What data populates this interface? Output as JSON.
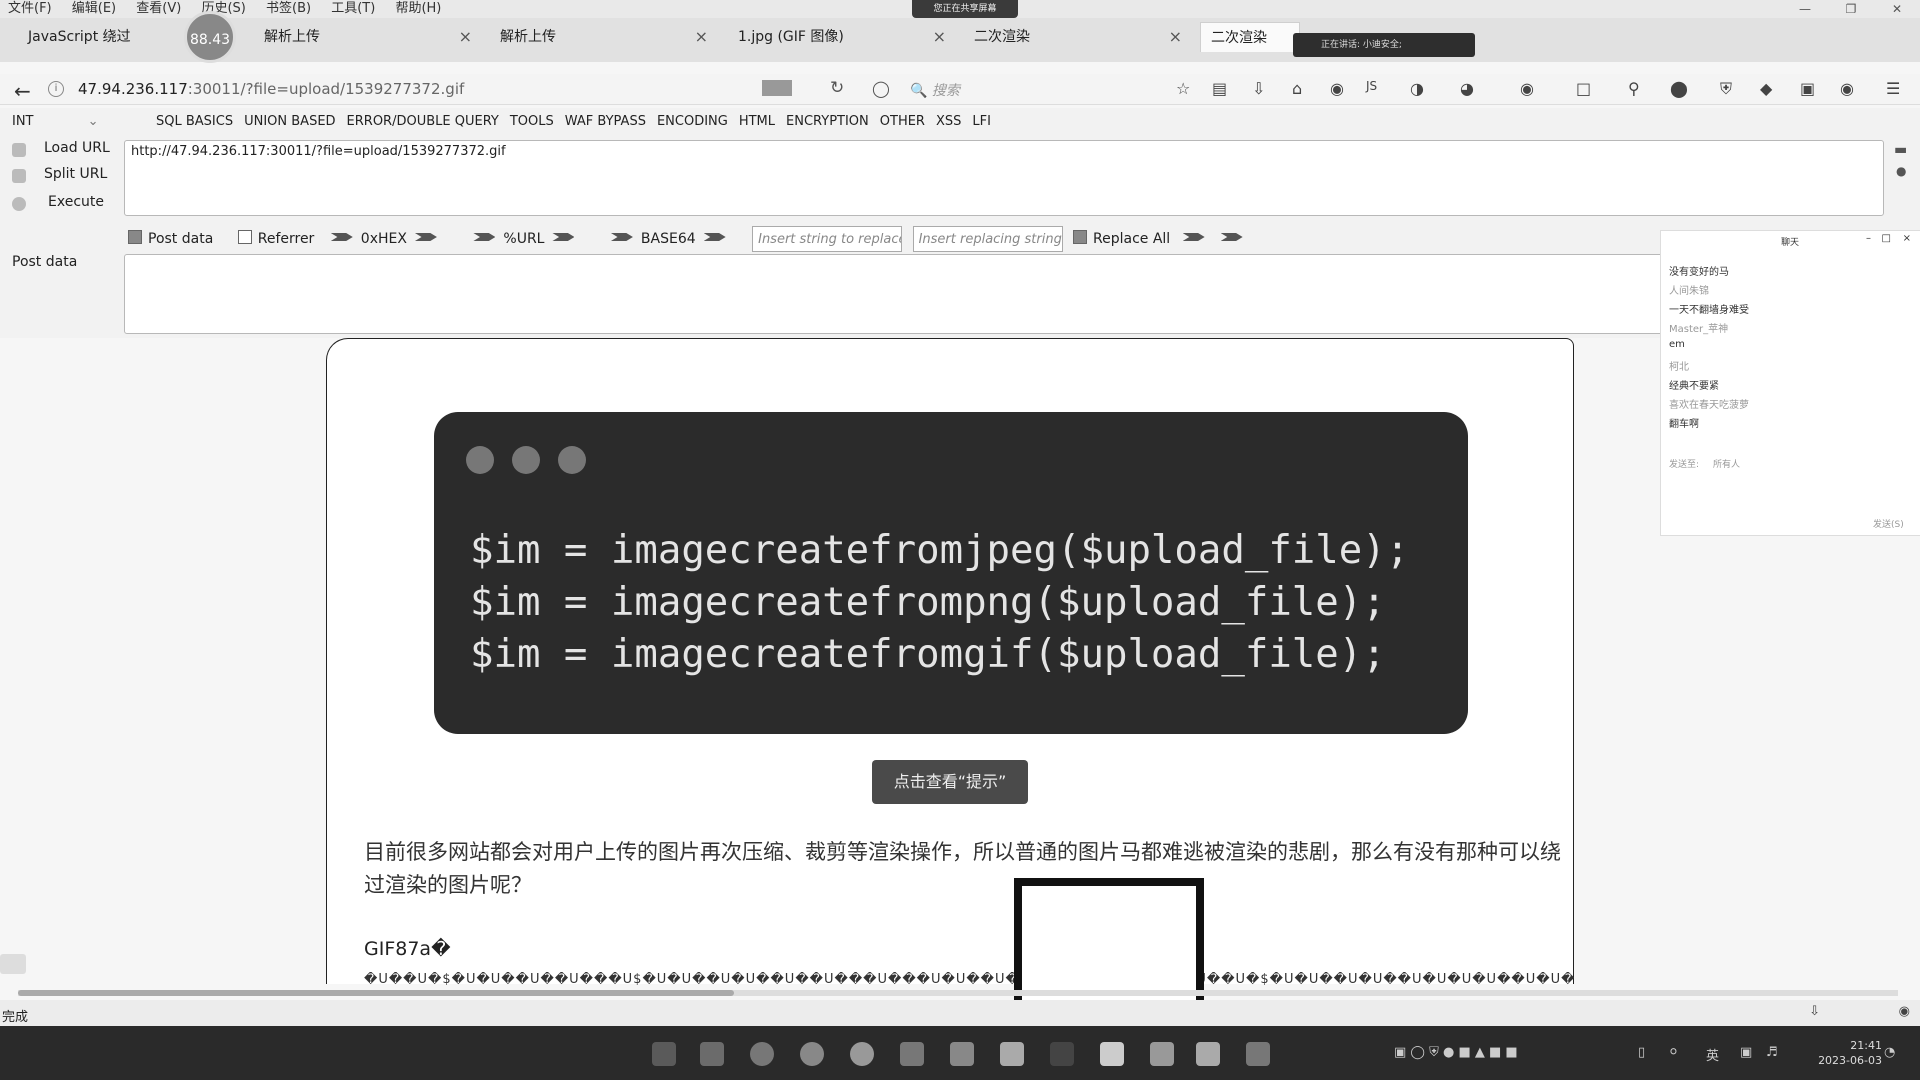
{
  "menubar": {
    "items": [
      "文件(F)",
      "编辑(E)",
      "查看(V)",
      "历史(S)",
      "书签(B)",
      "工具(T)",
      "帮助(H)"
    ],
    "sharing": "您正在共享屏幕"
  },
  "timer_badge": "88.43",
  "tabs": [
    {
      "label": "JavaScript 绕过",
      "active": false
    },
    {
      "label": "解析上传",
      "active": false
    },
    {
      "label": "解析上传",
      "active": false
    },
    {
      "label": "1.jpg (GIF 图像)",
      "active": false
    },
    {
      "label": "二次渲染",
      "active": false
    },
    {
      "label": "二次渲染",
      "active": true
    }
  ],
  "tab_close": "×",
  "talk_indicator": "正在讲话: 小迪安全;",
  "navbar": {
    "host": "47.94.236.117",
    "path": ":30011/?file=upload/1539277372.gif",
    "search_placeholder": "搜索"
  },
  "hackbar": {
    "type_select": "INT",
    "menu": [
      "SQL BASICS",
      "UNION BASED",
      "ERROR/DOUBLE QUERY",
      "TOOLS",
      "WAF BYPASS",
      "ENCODING",
      "HTML",
      "ENCRYPTION",
      "OTHER",
      "XSS",
      "LFI"
    ],
    "load_url": "Load URL",
    "split_url": "Split URL",
    "execute": "Execute",
    "url_value": "http://47.94.236.117:30011/?file=upload/1539277372.gif",
    "post_data_chk": "Post data",
    "referrer_chk": "Referrer",
    "hex": "0xHEX",
    "urlenc": "%URL",
    "base64": "BASE64",
    "insert_find_ph": "Insert string to replace",
    "insert_replace_ph": "Insert replacing string",
    "replace_all": "Replace All",
    "post_label": "Post data"
  },
  "page": {
    "code_lines": [
      "$im = imagecreatefromjpeg($upload_file);",
      "$im = imagecreatefrompng($upload_file);",
      "$im = imagecreatefromgif($upload_file);"
    ],
    "hint_button": "点击查看“提示”",
    "paragraph": "目前很多网站都会对用户上传的图片再次压缩、裁剪等渲染操作，所以普通的图片马都难逃被渲染的悲剧，那么有没有那种可以绕过渲染的图片呢？",
    "gif_header": "GIF87a�",
    "garbage_line": "�U��U�$�U�U��U��U���U$�U�U��U�U��U��U���U���U�U��U�U��U�U��U�$�U�U��U�$�U�U��U�U��U�U�U�U��U�U��U�U��U�U��U�U��U$�U$�U��U�U��U$�U�U��U�U��U�U��U�U��U$�U�U�"
  },
  "chat": {
    "title": "聊天",
    "messages": [
      {
        "text": "没有变好的马",
        "light": false
      },
      {
        "text": "人间朱锦",
        "light": true
      },
      {
        "text": "一天不翻墙身难受",
        "light": false
      },
      {
        "text": "Master_苹神",
        "light": true
      },
      {
        "text": "em",
        "light": false
      },
      {
        "text": "柯北",
        "light": true
      },
      {
        "text": "经典不要紧",
        "light": false
      },
      {
        "text": "喜欢在春天吃菠萝",
        "light": true
      },
      {
        "text": "翻车啊",
        "light": false
      }
    ],
    "send_to_label": "发送至:",
    "send_to_value": "所有人",
    "send_button": "发送(S)"
  },
  "statusbar": {
    "text": "完成"
  },
  "taskbar": {
    "ime": "英",
    "time": "21:41",
    "date": "2023-06-03"
  }
}
